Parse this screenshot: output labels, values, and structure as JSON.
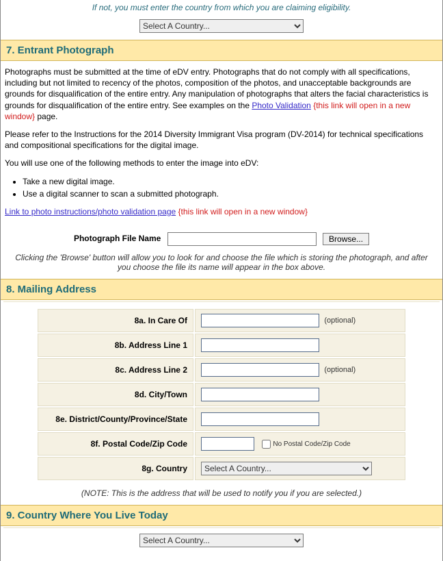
{
  "top": {
    "eligibility_instr": "If not, you must enter the country from which you are claiming eligibility.",
    "country_placeholder": "Select A Country..."
  },
  "section7": {
    "title": "7. Entrant Photograph",
    "para1_a": "Photographs must be submitted at the time of eDV entry. Photographs that do not comply with all specifications, including but not limited to recency of the photos, composition of the photos, and unacceptable backgrounds are grounds for disqualification of the entire entry. Any manipulation of photographs that alters the facial characteristics is grounds for disqualification of the entire entry. See examples on the ",
    "photo_validation_link": "Photo Validation",
    "new_window": "{this link will open in a new window}",
    "para1_b": " page.",
    "para2": "Please refer to the Instructions for the 2014 Diversity Immigrant Visa program (DV-2014) for technical specifications and compositional specifications for the digital image.",
    "para3": "You will use one of the following methods to enter the image into eDV:",
    "method1": "Take a new digital image.",
    "method2": "Use a digital scanner to scan a submitted photograph.",
    "instructions_link": "Link to photo instructions/photo validation page",
    "file_label": "Photograph File Name",
    "browse_label": "Browse...",
    "browse_hint": "Clicking the 'Browse' button will allow you to look for and choose the file which is storing the photograph, and after you choose the file its name will appear in the box above."
  },
  "section8": {
    "title": "8. Mailing Address",
    "fields": {
      "care_of": "8a. In Care Of",
      "addr1": "8b. Address Line 1",
      "addr2": "8c. Address Line 2",
      "city": "8d. City/Town",
      "district": "8e. District/County/Province/State",
      "postal": "8f. Postal Code/Zip Code",
      "country": "8g. Country"
    },
    "optional": "(optional)",
    "no_zip": "No Postal Code/Zip Code",
    "country_placeholder": "Select A Country...",
    "note": "(NOTE: This is the address that will be used to notify you if you are selected.)"
  },
  "section9": {
    "title": "9. Country Where You Live Today",
    "country_placeholder": "Select A Country..."
  }
}
